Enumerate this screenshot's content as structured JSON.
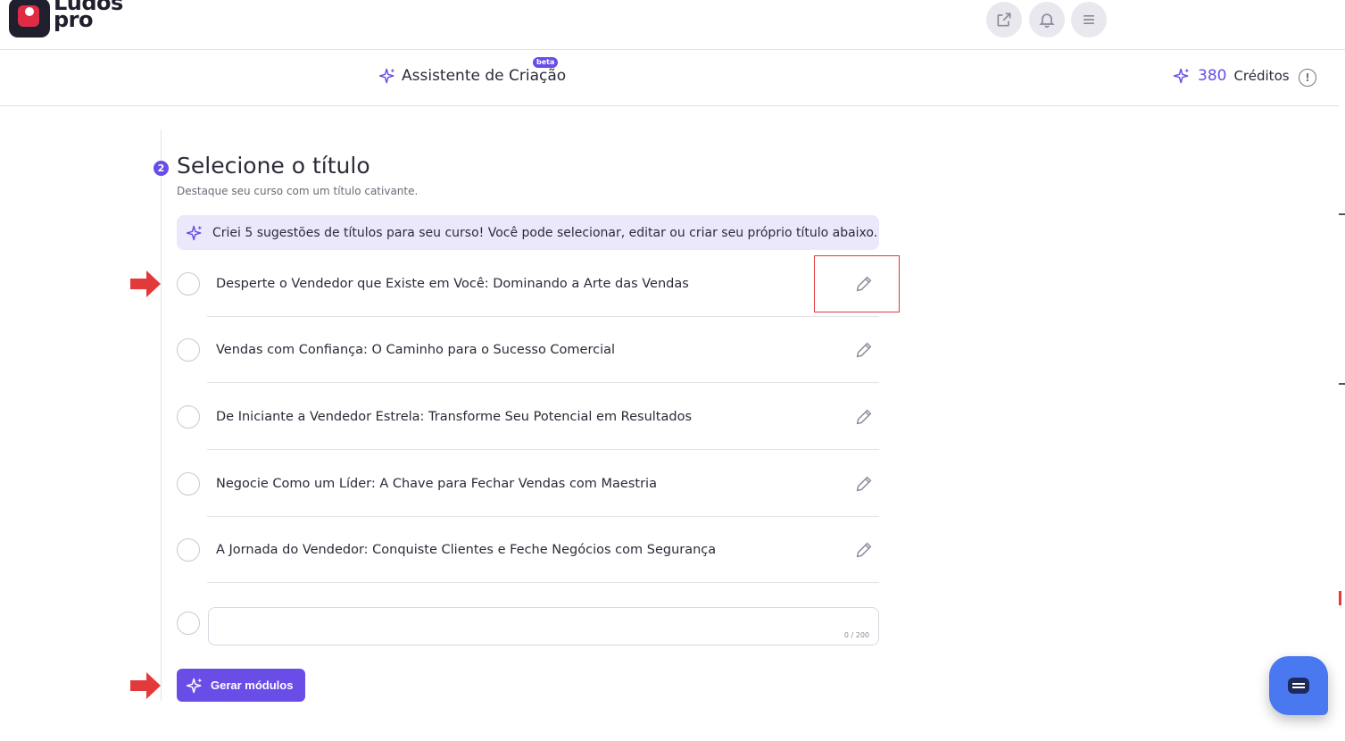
{
  "brand": {
    "logo_line1": "Ludos",
    "logo_line2": "pro"
  },
  "topbar": {
    "icons": [
      "external-link-icon",
      "bell-icon",
      "menu-icon"
    ]
  },
  "subheader": {
    "assistant_label": "Assistente de Criação",
    "beta_badge": "beta",
    "credits_value": "380",
    "credits_label": "Créditos"
  },
  "step": {
    "number": "2",
    "title": "Selecione o título",
    "subtitle": "Destaque seu curso com um título cativante.",
    "hint": "Criei 5 sugestões de títulos para seu curso! Você pode selecionar, editar ou criar seu próprio título abaixo."
  },
  "options": [
    {
      "label": "Desperte o Vendedor que Existe em Você: Dominando a Arte das Vendas"
    },
    {
      "label": "Vendas com Confiança: O Caminho para o Sucesso Comercial"
    },
    {
      "label": "De Iniciante a Vendedor Estrela: Transforme Seu Potencial em Resultados"
    },
    {
      "label": "Negocie Como um Líder: A Chave para Fechar Vendas com Maestria"
    },
    {
      "label": "A Jornada do Vendedor: Conquiste Clientes e Feche Negócios com Segurança"
    }
  ],
  "custom_title": {
    "value": "",
    "counter": "0 / 200"
  },
  "generate_button": {
    "label": "Gerar módulos"
  },
  "colors": {
    "accent": "#6a4de6",
    "hint_bg": "#ece8fc",
    "annotation": "#e23a3a",
    "chat": "#4a78f0"
  }
}
